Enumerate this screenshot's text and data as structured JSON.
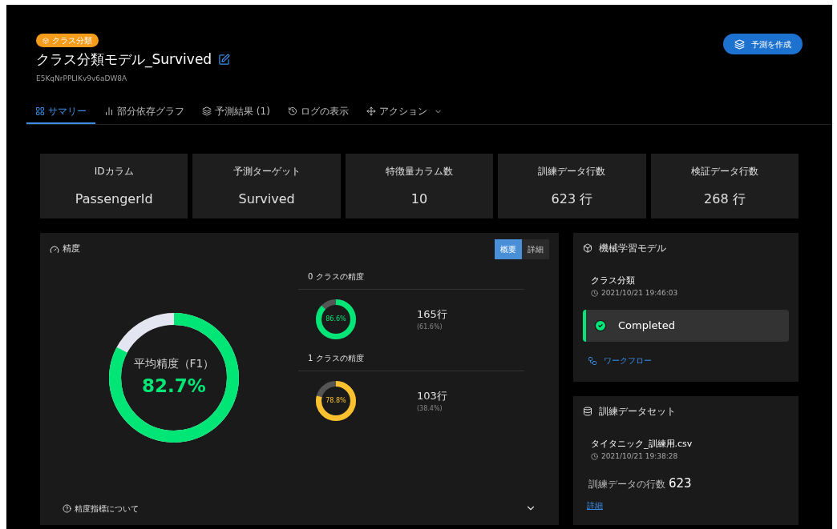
{
  "header": {
    "badge": "クラス分類",
    "title": "クラス分類モデル_Survived",
    "id_text": "E5KqNrPPLIKv9v6aDW8A",
    "create_button": "予測を作成"
  },
  "tabs": [
    {
      "label": "サマリー",
      "selected": true
    },
    {
      "label": "部分依存グラフ",
      "selected": false
    },
    {
      "label": "予測結果 (1)",
      "selected": false
    },
    {
      "label": "ログの表示",
      "selected": false
    },
    {
      "label": "アクション",
      "selected": false,
      "dropdown": true
    }
  ],
  "stats": [
    {
      "label": "IDカラム",
      "value": "PassengerId"
    },
    {
      "label": "予測ターゲット",
      "value": "Survived"
    },
    {
      "label": "特徴量カラム数",
      "value": "10"
    },
    {
      "label": "訓練データ行数",
      "value": "623 行"
    },
    {
      "label": "検証データ行数",
      "value": "268 行"
    }
  ],
  "accuracy": {
    "title": "精度",
    "views": [
      {
        "label": "概要",
        "selected": true
      },
      {
        "label": "詳細",
        "selected": false
      }
    ],
    "overall": {
      "label": "平均精度（F1）",
      "value": "82.7%",
      "level": 0.827
    },
    "classes": [
      {
        "title": "0 クラスの精度",
        "value": "86.6%",
        "level": 0.866,
        "color": "#00e676",
        "rows": "165行",
        "share": "(61.6%)"
      },
      {
        "title": "1 クラスの精度",
        "value": "78.8%",
        "level": 0.788,
        "color": "#fbc02d",
        "rows": "103行",
        "share": "(38.4%)"
      }
    ],
    "help": "精度指標について"
  },
  "model": {
    "title": "機械学習モデル",
    "name": "クラス分類",
    "time": "2021/10/21 19:46:03",
    "status": "Completed",
    "workflow": "ワークフロー"
  },
  "dataset": {
    "title": "訓練データセット",
    "file": "タイタニック_訓練用.csv",
    "time": "2021/10/21 19:38:28",
    "rows_label": "訓練データの行数",
    "rows_value": "623",
    "details": "詳細"
  }
}
